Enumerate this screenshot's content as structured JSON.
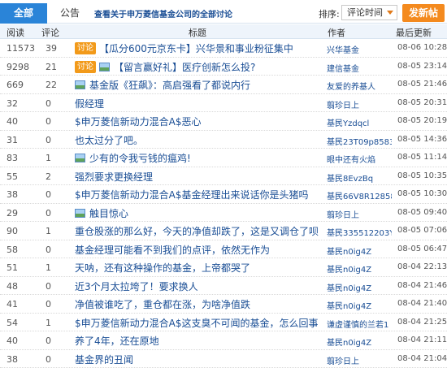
{
  "tabs": {
    "all": "全部",
    "notice": "公告"
  },
  "board_title": "查看关于申万菱信基金公司的全部讨论",
  "sort": {
    "label": "排序:",
    "selected": "评论时间"
  },
  "post_button": "发新帖",
  "columns": {
    "read": "阅读",
    "comment": "评论",
    "title": "标题",
    "author": "作者",
    "updated": "最后更新"
  },
  "rows": [
    {
      "read": "11573",
      "comment": "39",
      "tag": "讨论",
      "img": false,
      "title": "【瓜分600元京东卡】兴华景和事业粉征集中",
      "author": "兴华基金",
      "updated": "08-06 10:28"
    },
    {
      "read": "9298",
      "comment": "21",
      "tag": "讨论",
      "img": true,
      "title": "【留言赢好礼】医疗创新怎么投?",
      "author": "建信基金",
      "updated": "08-05 23:14"
    },
    {
      "read": "669",
      "comment": "22",
      "tag": "",
      "img": true,
      "title": "基金版《狂飙》：高启强看了都说内行",
      "author": "友爱的养基人",
      "updated": "08-05 21:46"
    },
    {
      "read": "32",
      "comment": "0",
      "tag": "",
      "img": false,
      "title": "假经理",
      "author": "翦珍日上",
      "updated": "08-05 20:31"
    },
    {
      "read": "40",
      "comment": "0",
      "tag": "",
      "img": false,
      "title": "$申万菱信新动力混合A$恶心",
      "author": "基民Yzdqcl",
      "updated": "08-05 20:19"
    },
    {
      "read": "31",
      "comment": "0",
      "tag": "",
      "img": false,
      "title": "也太过分了吧。",
      "author": "基民23T09p8583",
      "updated": "08-05 14:36"
    },
    {
      "read": "83",
      "comment": "1",
      "tag": "",
      "img": true,
      "title": "少有的令我亏钱的瘟鸡!",
      "author": "眼中还有火焰",
      "updated": "08-05 11:14"
    },
    {
      "read": "55",
      "comment": "2",
      "tag": "",
      "img": false,
      "title": "强烈要求更换经理",
      "author": "基民8EvzBq",
      "updated": "08-05 10:35"
    },
    {
      "read": "38",
      "comment": "0",
      "tag": "",
      "img": false,
      "title": "$申万菱信新动力混合A$基金经理出来说话你是头猪吗",
      "author": "基民66V8R12858",
      "updated": "08-05 10:30"
    },
    {
      "read": "29",
      "comment": "0",
      "tag": "",
      "img": true,
      "title": "触目惊心",
      "author": "翦珍日上",
      "updated": "08-05 09:40"
    },
    {
      "read": "90",
      "comment": "1",
      "tag": "",
      "img": false,
      "title": "重仓股涨的那么好，今天的净值却跌了，这是又调仓了呗",
      "author": "基民335512203Y",
      "updated": "08-05 07:06"
    },
    {
      "read": "58",
      "comment": "0",
      "tag": "",
      "img": false,
      "title": "基金经理可能看不到我们的点评，依然无作为",
      "author": "基民n0ig4Z",
      "updated": "08-05 06:47"
    },
    {
      "read": "51",
      "comment": "1",
      "tag": "",
      "img": false,
      "title": "天呐，还有这种操作的基金，上帝都哭了",
      "author": "基民n0ig4Z",
      "updated": "08-04 22:13"
    },
    {
      "read": "48",
      "comment": "0",
      "tag": "",
      "img": false,
      "title": "近3个月太拉垮了！要求换人",
      "author": "基民n0ig4Z",
      "updated": "08-04 21:46"
    },
    {
      "read": "41",
      "comment": "0",
      "tag": "",
      "img": false,
      "title": "净值被谁吃了，重仓都在涨，为啥净值跌",
      "author": "基民n0ig4Z",
      "updated": "08-04 21:40"
    },
    {
      "read": "54",
      "comment": "1",
      "tag": "",
      "img": false,
      "title": "$申万菱信新动力混合A$这支臭不可闻的基金，怎么回事",
      "author": "谦虚谨慎的兰若1",
      "updated": "08-04 21:25"
    },
    {
      "read": "40",
      "comment": "0",
      "tag": "",
      "img": false,
      "title": "养了4年，还在原地",
      "author": "基民n0ig4Z",
      "updated": "08-04 21:11"
    },
    {
      "read": "38",
      "comment": "0",
      "tag": "",
      "img": false,
      "title": "基金界的丑闻",
      "author": "翦珍日上",
      "updated": "08-04 21:04"
    }
  ]
}
